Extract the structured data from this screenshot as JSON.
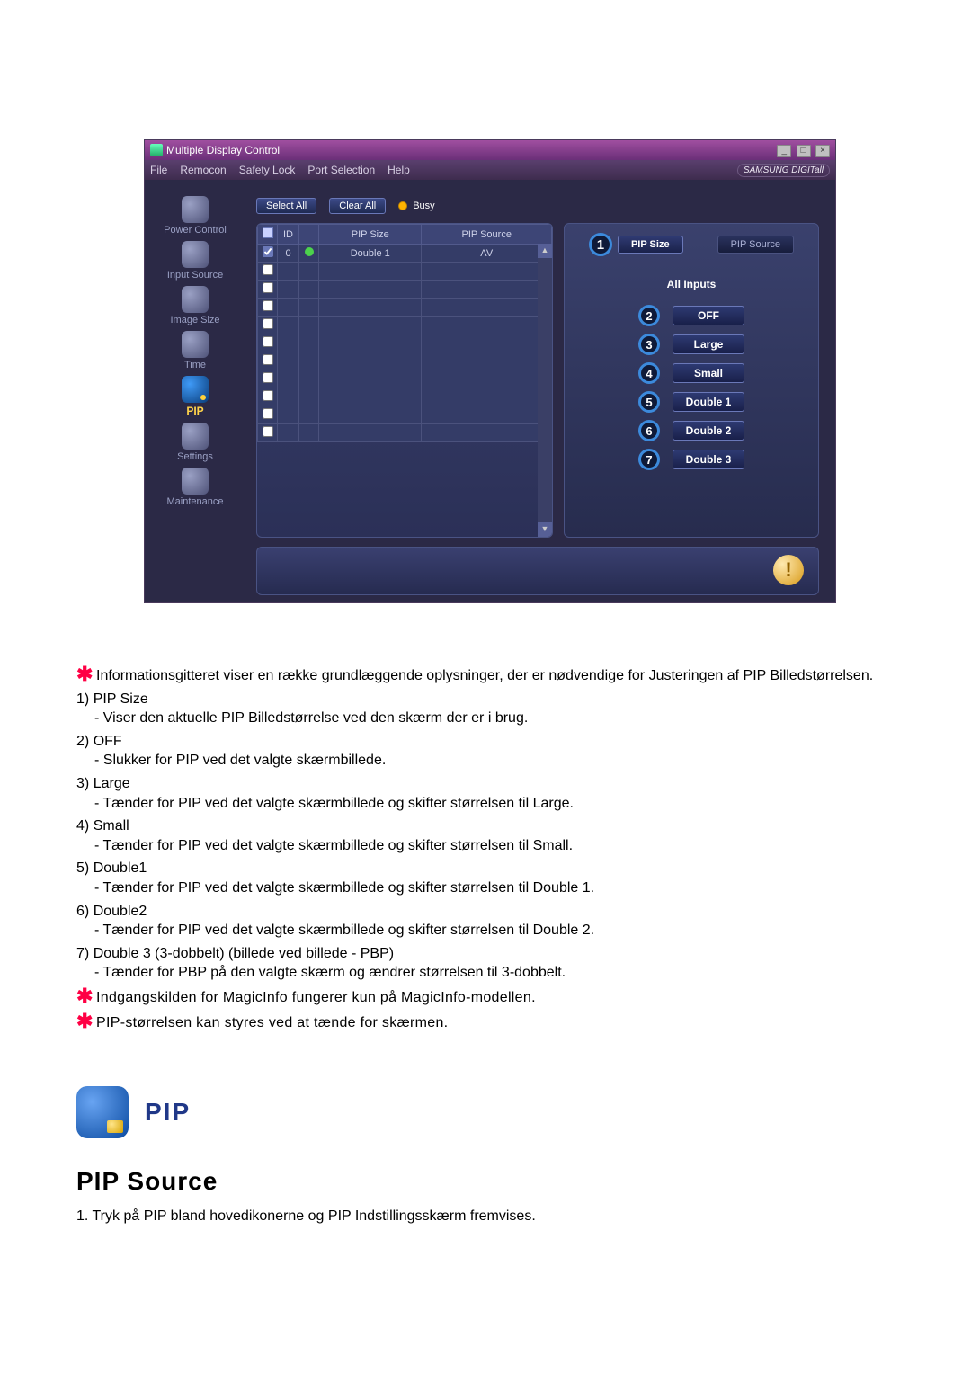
{
  "app": {
    "title": "Multiple Display Control",
    "menu": {
      "file": "File",
      "remocon": "Remocon",
      "safety": "Safety Lock",
      "port": "Port Selection",
      "help": "Help"
    },
    "brand": "SAMSUNG DIGITall"
  },
  "nav": {
    "power": "Power Control",
    "input": "Input Source",
    "image": "Image Size",
    "time": "Time",
    "pip": "PIP",
    "settings": "Settings",
    "maintenance": "Maintenance"
  },
  "toolbar": {
    "select_all": "Select All",
    "clear_all": "Clear All",
    "busy": "Busy"
  },
  "grid": {
    "col_id": "ID",
    "col_pipsize": "PIP Size",
    "col_pipsource": "PIP Source",
    "row0": {
      "id": "0",
      "size": "Double 1",
      "source": "AV"
    }
  },
  "right": {
    "tab_pipsize": "PIP Size",
    "tab_pipsource": "PIP Source",
    "all_inputs": "All Inputs",
    "m1": "1",
    "m2": "2",
    "m3": "3",
    "m4": "4",
    "m5": "5",
    "m6": "6",
    "m7": "7",
    "off": "OFF",
    "large": "Large",
    "small": "Small",
    "double1": "Double 1",
    "double2": "Double 2",
    "double3": "Double 3"
  },
  "desc": {
    "info_grid": "Informationsgitteret viser en række grundlæggende oplysninger, der er nødvendige for Justeringen af PIP Billedstørrelsen.",
    "n1": "1)",
    "h1": "PIP Size",
    "s1": "- Viser den aktuelle PIP Billedstørrelse ved den skærm der er i brug.",
    "n2": "2)",
    "h2": "OFF",
    "s2": "- Slukker for PIP ved det valgte skærmbillede.",
    "n3": "3)",
    "h3": "Large",
    "s3": "- Tænder for PIP ved det valgte skærmbillede og skifter størrelsen til Large.",
    "n4": "4)",
    "h4": "Small",
    "s4": "- Tænder for PIP ved det valgte skærmbillede og skifter størrelsen til Small.",
    "n5": "5)",
    "h5": "Double1",
    "s5": "- Tænder for PIP ved det valgte skærmbillede og skifter størrelsen til Double 1.",
    "n6": "6)",
    "h6": "Double2",
    "s6": "- Tænder for PIP ved det valgte skærmbillede og skifter størrelsen til Double 2.",
    "n7": "7)",
    "h7": "Double 3 (3-dobbelt) (billede ved billede - PBP)",
    "s7": "- Tænder for PBP på den valgte skærm og ændrer størrelsen til 3-dobbelt.",
    "star_magic": "Indgangskilden for MagicInfo fungerer kun på MagicInfo-modellen.",
    "star_size": "PIP-størrelsen kan styres ved at tænde for skærmen."
  },
  "pip_section": {
    "title": "PIP",
    "subtitle": "PIP Source",
    "step1": "1.  Tryk på PIP bland hovedikonerne og PIP Indstillingsskærm fremvises."
  }
}
